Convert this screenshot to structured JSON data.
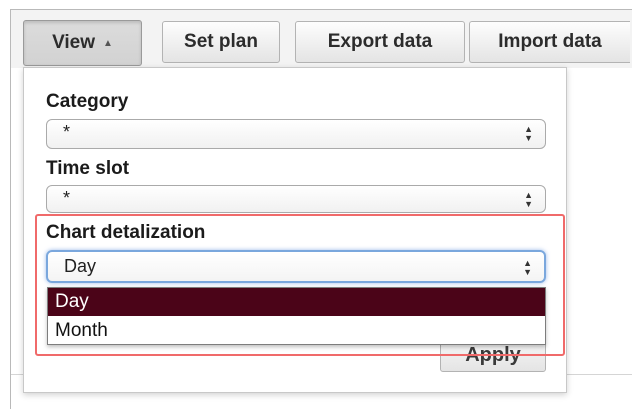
{
  "toolbar": {
    "view_label": "View",
    "view_caret": "▲",
    "setplan_label": "Set plan",
    "export_label": "Export data",
    "import_label": "Import data"
  },
  "dropdown": {
    "category": {
      "label": "Category",
      "value": "*"
    },
    "time_slot": {
      "label": "Time slot",
      "value": "*"
    },
    "chart_detalization": {
      "label": "Chart detalization",
      "value": "Day",
      "options": [
        "Day",
        "Month"
      ],
      "selected_index": 0
    },
    "apply_label": "Apply"
  },
  "colors": {
    "selected_option_bg": "#4b0418",
    "highlight_border": "#f06a6a",
    "focus_ring": "#7aa7dd"
  }
}
